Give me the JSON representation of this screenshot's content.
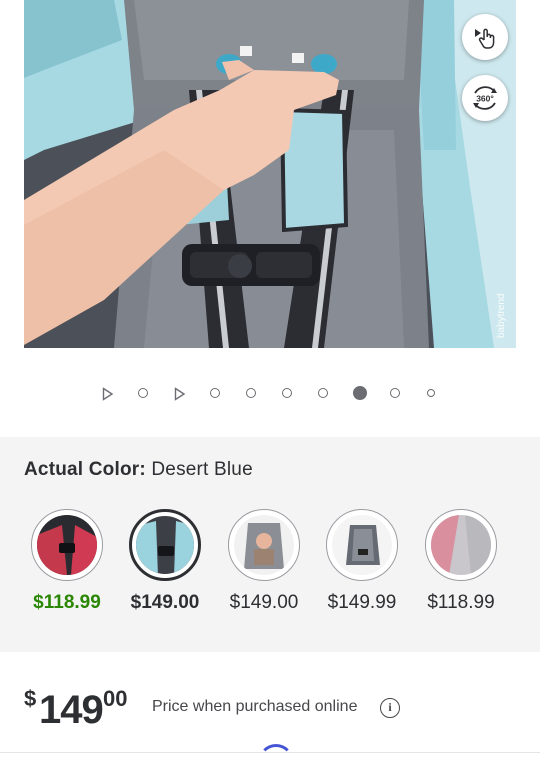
{
  "gallery": {
    "active_index": 7,
    "total_items": 10,
    "controls": {
      "tap_view_icon": "tap-hand-icon",
      "spin_view_icon": "360-view-icon",
      "spin_view_label": "360°"
    },
    "watermark": "babytrend"
  },
  "color": {
    "label": "Actual Color:",
    "value": "Desert Blue",
    "swatches": [
      {
        "price": "$118.99",
        "state": "sale"
      },
      {
        "price": "$149.00",
        "state": "selected"
      },
      {
        "price": "$149.00",
        "state": "default"
      },
      {
        "price": "$149.99",
        "state": "default"
      },
      {
        "price": "$118.99",
        "state": "default"
      }
    ]
  },
  "price": {
    "currency": "$",
    "dollars": "149",
    "cents": "00",
    "note": "Price when purchased online",
    "info_icon": "info-icon",
    "info_glyph": "i"
  },
  "colors": {
    "accent_green": "#2a8703",
    "text": "#2e2f32",
    "spinner": "#4655d6"
  }
}
